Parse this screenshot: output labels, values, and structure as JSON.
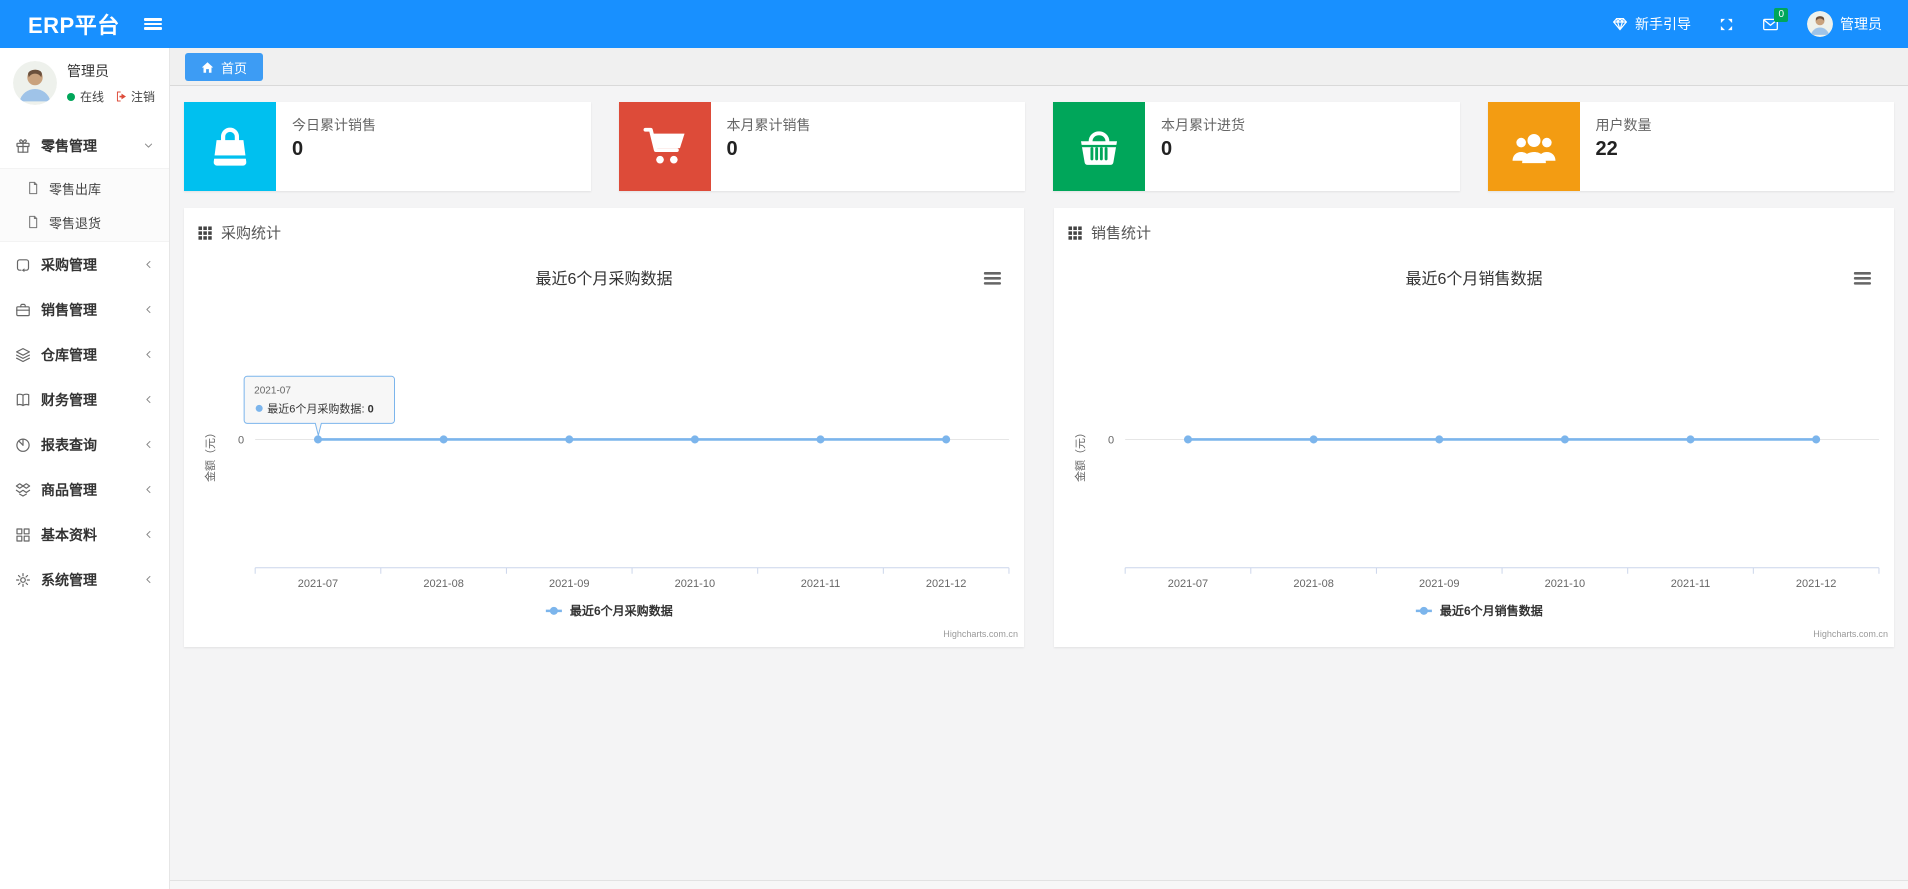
{
  "navbar": {
    "brand": "ERP平台",
    "guide_label": "新手引导",
    "badge_count": "0",
    "username": "管理员"
  },
  "sidebar": {
    "user": {
      "name": "管理员",
      "status_online": "在线",
      "logout_label": "注销"
    },
    "items": [
      {
        "label": "零售管理",
        "icon": "gift",
        "state": "expanded",
        "children": [
          {
            "label": "零售出库",
            "icon": "file"
          },
          {
            "label": "零售退货",
            "icon": "file"
          }
        ]
      },
      {
        "label": "采购管理",
        "icon": "loop",
        "state": "collapsed"
      },
      {
        "label": "销售管理",
        "icon": "briefcase",
        "state": "collapsed"
      },
      {
        "label": "仓库管理",
        "icon": "layers",
        "state": "collapsed"
      },
      {
        "label": "财务管理",
        "icon": "book",
        "state": "collapsed"
      },
      {
        "label": "报表查询",
        "icon": "pie",
        "state": "collapsed"
      },
      {
        "label": "商品管理",
        "icon": "box",
        "state": "collapsed"
      },
      {
        "label": "基本资料",
        "icon": "grid",
        "state": "collapsed"
      },
      {
        "label": "系统管理",
        "icon": "gear",
        "state": "collapsed"
      }
    ]
  },
  "tabs": [
    {
      "label": "首页",
      "icon": "home",
      "active": true
    }
  ],
  "stats": [
    {
      "label": "今日累计销售",
      "value": "0",
      "icon": "bag",
      "color": "#00c0ef"
    },
    {
      "label": "本月累计销售",
      "value": "0",
      "icon": "cart",
      "color": "#dd4b39"
    },
    {
      "label": "本月累计进货",
      "value": "0",
      "icon": "basket",
      "color": "#00a65a"
    },
    {
      "label": "用户数量",
      "value": "22",
      "icon": "users",
      "color": "#f39c12"
    }
  ],
  "colors": {
    "navbar": "#1890ff",
    "series": "#7cb5ec",
    "badge": "#00a65a",
    "online": "#00a65a"
  },
  "chart_data": [
    {
      "type": "line",
      "panel_title": "采购统计",
      "title": "最近6个月采购数据",
      "categories": [
        "2021-07",
        "2021-08",
        "2021-09",
        "2021-10",
        "2021-11",
        "2021-12"
      ],
      "series": [
        {
          "name": "最近6个月采购数据",
          "values": [
            0,
            0,
            0,
            0,
            0,
            0
          ],
          "color": "#7cb5ec"
        }
      ],
      "xlabel": "",
      "ylabel": "金额（元）",
      "yticks": [
        "0"
      ],
      "grid": "zero-line-only",
      "legend_position": "bottom",
      "credits": "Highcharts.com.cn",
      "tooltip": {
        "visible": true,
        "header": "2021-07",
        "series": "最近6个月采购数据",
        "value": "0"
      }
    },
    {
      "type": "line",
      "panel_title": "销售统计",
      "title": "最近6个月销售数据",
      "categories": [
        "2021-07",
        "2021-08",
        "2021-09",
        "2021-10",
        "2021-11",
        "2021-12"
      ],
      "series": [
        {
          "name": "最近6个月销售数据",
          "values": [
            0,
            0,
            0,
            0,
            0,
            0
          ],
          "color": "#7cb5ec"
        }
      ],
      "xlabel": "",
      "ylabel": "金额（元）",
      "yticks": [
        "0"
      ],
      "grid": "zero-line-only",
      "legend_position": "bottom",
      "credits": "Highcharts.com.cn",
      "tooltip": {
        "visible": false
      }
    }
  ]
}
